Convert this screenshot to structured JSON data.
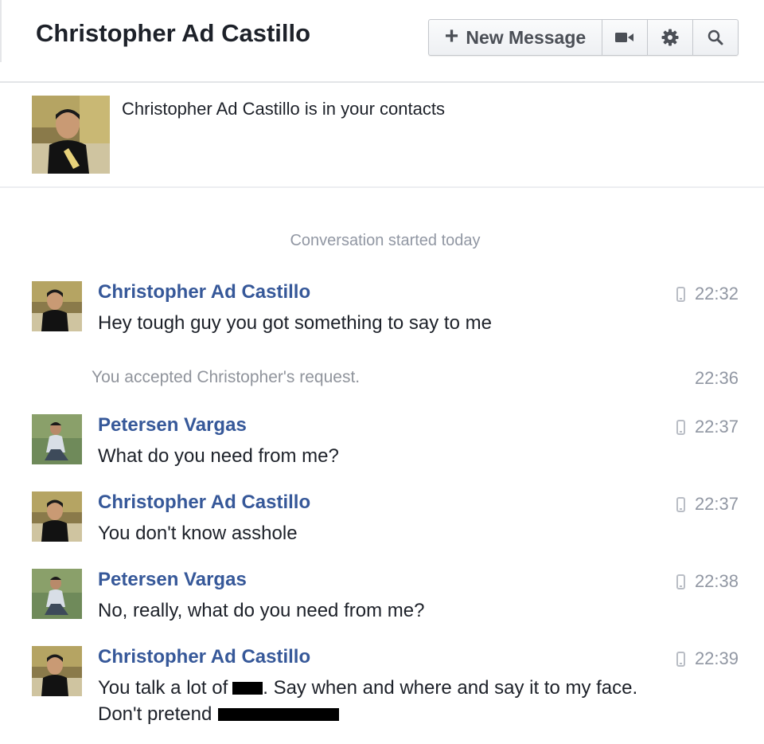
{
  "header": {
    "title": "Christopher Ad Castillo",
    "toolbar": {
      "new_message_label": "New Message",
      "new_message_icon": "plus-icon",
      "video_icon": "video-camera-icon",
      "settings_icon": "gear-icon",
      "search_icon": "search-icon"
    }
  },
  "contact_banner": {
    "text": "Christopher Ad Castillo is in your contacts"
  },
  "conversation": {
    "started_label": "Conversation started today",
    "event": {
      "text": "You accepted Christopher's request.",
      "time": "22:36"
    },
    "messages": [
      {
        "sender": "Christopher Ad Castillo",
        "text": "Hey tough guy you got something to say to me",
        "time": "22:32"
      },
      {
        "sender": "Petersen Vargas",
        "text": "What do you need from me?",
        "time": "22:37"
      },
      {
        "sender": "Christopher Ad Castillo",
        "text": "You don't know asshole",
        "time": "22:37"
      },
      {
        "sender": "Petersen Vargas",
        "text": "No, really, what do you need from me?",
        "time": "22:38"
      },
      {
        "sender": "Christopher Ad Castillo",
        "text_part1": "You talk a lot of",
        "text_part2": ". Say when and where and say it to my face. Don't pretend",
        "time": "22:39"
      }
    ]
  },
  "colors": {
    "sender_name": "#365899",
    "meta_text": "#9197a3",
    "body_text": "#1d2129"
  }
}
